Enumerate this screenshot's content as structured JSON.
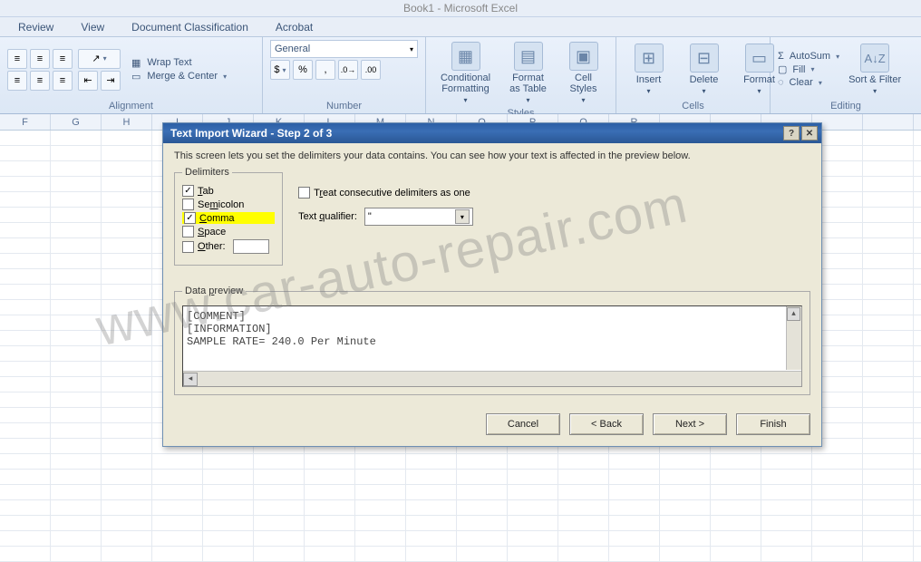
{
  "app": {
    "title": "Book1 - Microsoft Excel"
  },
  "tabs": {
    "review": "Review",
    "view": "View",
    "docclass": "Document Classification",
    "acrobat": "Acrobat"
  },
  "ribbon": {
    "alignment": {
      "wrap": "Wrap Text",
      "merge": "Merge & Center",
      "label": "Alignment"
    },
    "number": {
      "format": "General",
      "label": "Number"
    },
    "styles": {
      "cond": "Conditional Formatting",
      "fmttable": "Format as Table",
      "cellstyles": "Cell Styles",
      "label": "Styles"
    },
    "cells": {
      "insert": "Insert",
      "delete": "Delete",
      "format": "Format",
      "label": "Cells"
    },
    "editing": {
      "autosum": "AutoSum",
      "fill": "Fill",
      "clear": "Clear",
      "sortfilter": "Sort & Filter",
      "label": "Editing"
    }
  },
  "columns": [
    "F",
    "G",
    "H",
    "I",
    "J",
    "K",
    "L",
    "M",
    "N",
    "O",
    "P",
    "Q",
    "R"
  ],
  "dialog": {
    "title": "Text Import Wizard - Step 2 of 3",
    "instruction": "This screen lets you set the delimiters your data contains.  You can see how your text is affected in the preview below.",
    "delimiters_legend": "Delimiters",
    "tab": "Tab",
    "semicolon": "Semicolon",
    "comma": "Comma",
    "space": "Space",
    "other": "Other:",
    "treat": "Treat consecutive delimiters as one",
    "qualifier_label": "Text qualifier:",
    "qualifier_value": "\"",
    "preview_legend": "Data preview",
    "preview_lines": {
      "l1": "[COMMENT]",
      "l2": " ",
      "l3": "[INFORMATION]",
      "l4": "SAMPLE RATE= 240.0 Per Minute"
    },
    "buttons": {
      "cancel": "Cancel",
      "back": "< Back",
      "next": "Next >",
      "finish": "Finish"
    }
  },
  "watermark": "www.car-auto-repair.com"
}
